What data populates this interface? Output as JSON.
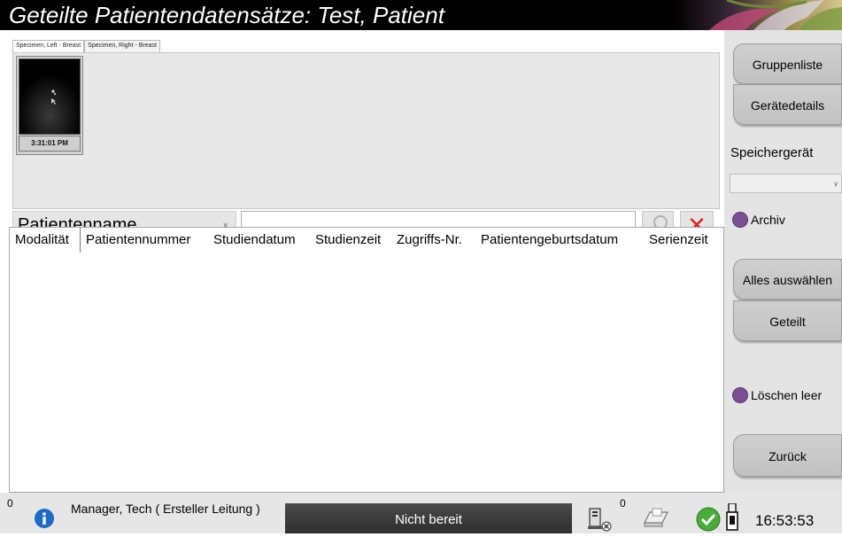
{
  "window": {
    "title": "Geteilte Patientendatensätze: Test, Patient"
  },
  "tabs": [
    {
      "label": "Specimen, Left - Breast",
      "active": true
    },
    {
      "label": "Specimen, Right - Breast",
      "active": false
    }
  ],
  "thumbnail": {
    "timestamp": "3:31:01 PM"
  },
  "search": {
    "field_selected": "Patientenname",
    "query": ""
  },
  "table": {
    "columns": [
      "Modalität",
      "Patientennummer",
      "Studiendatum",
      "Studienzeit",
      "Zugriffs-Nr.",
      "Patientengeburtsdatum",
      "Serienzeit"
    ],
    "rows": []
  },
  "sidebar": {
    "group_list": "Gruppenliste",
    "device_details": "Gerätedetails",
    "storage_label": "Speichergerät",
    "storage_value": "",
    "archive_label": "Archiv",
    "select_all": "Alles auswählen",
    "shared": "Geteilt",
    "delete_empty": "Löschen leer",
    "back": "Zurück"
  },
  "status": {
    "left_count": "0",
    "user": "Manager, Tech ( Ersteller Leitung )",
    "state": "Nicht bereit",
    "queue_count": "0",
    "time": "16:53:53"
  },
  "colors": {
    "title_bg": "#000000",
    "radio": "#7a5090",
    "sidebar_bg": "#e4e4e4",
    "status_dark": "#2e2e2e"
  },
  "icons": [
    "flower-banner-icon",
    "search-icon",
    "close-icon",
    "info-icon",
    "network-disconnected-icon",
    "print-queue-icon",
    "ok-check-icon",
    "usb-icon"
  ]
}
